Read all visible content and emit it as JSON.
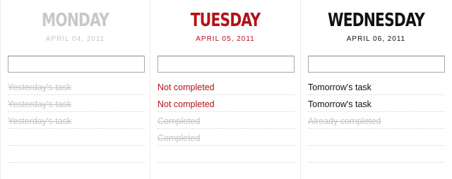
{
  "days": [
    {
      "name": "Monday",
      "date": "April 04, 2011",
      "input_value": "",
      "tasks": [
        {
          "text": "Yesterday's task",
          "done": true
        },
        {
          "text": "Yesterday's task",
          "done": true
        },
        {
          "text": "Yesterday's task",
          "done": true
        },
        {
          "text": "",
          "done": false
        },
        {
          "text": "",
          "done": false
        }
      ]
    },
    {
      "name": "Tuesday",
      "date": "April 05, 2011",
      "input_value": "",
      "tasks": [
        {
          "text": "Not completed",
          "done": false
        },
        {
          "text": "Not completed",
          "done": false
        },
        {
          "text": "Completed",
          "done": true
        },
        {
          "text": "Completed",
          "done": true
        },
        {
          "text": "",
          "done": false
        }
      ]
    },
    {
      "name": "Wednesday",
      "date": "April 06, 2011",
      "input_value": "",
      "tasks": [
        {
          "text": "Tomorrow's task",
          "done": false
        },
        {
          "text": "Tomorrow's task",
          "done": false
        },
        {
          "text": "Already completed",
          "done": true
        },
        {
          "text": "",
          "done": false
        },
        {
          "text": "",
          "done": false
        }
      ]
    }
  ],
  "colors": {
    "past": "#c8c8c8",
    "today": "#b31216",
    "future": "#111111",
    "done_text": "#c4c4c4",
    "divider": "#ebebeb"
  }
}
